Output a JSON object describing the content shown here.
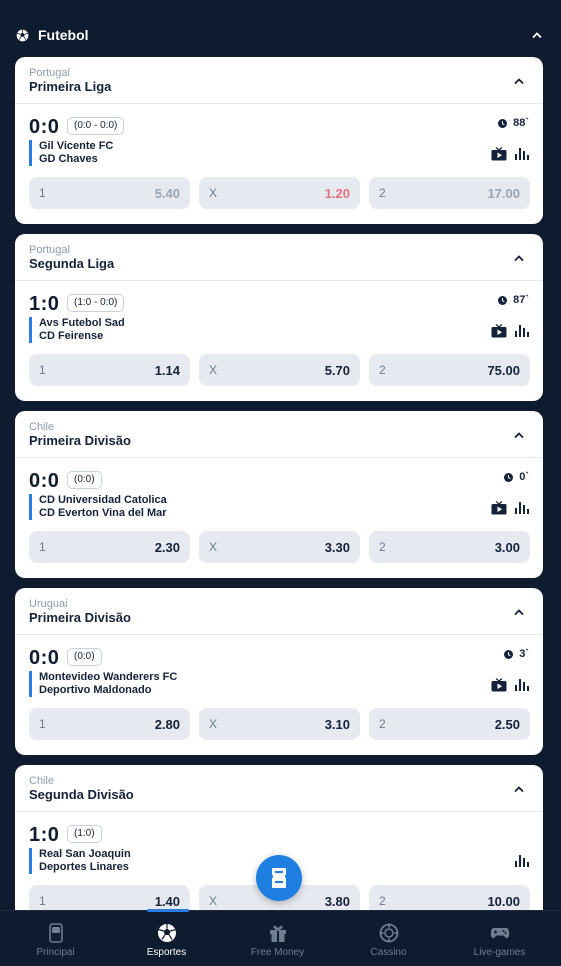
{
  "sport": {
    "title": "Futebol"
  },
  "matches": [
    {
      "country": "Portugal",
      "league": "Primeira Liga",
      "score": "0:0",
      "partial": "(0:0 - 0:0)",
      "home": "Gil Vicente FC",
      "away": "GD Chaves",
      "time": "88`",
      "has_tv": true,
      "odds": [
        {
          "label": "1",
          "value": "5.40"
        },
        {
          "label": "X",
          "value": "1.20"
        },
        {
          "label": "2",
          "value": "17.00"
        }
      ]
    },
    {
      "country": "Portugal",
      "league": "Segunda Liga",
      "score": "1:0",
      "partial": "(1:0 - 0:0)",
      "home": "Avs Futebol Sad",
      "away": "CD Feirense",
      "time": "87`",
      "has_tv": true,
      "odds": [
        {
          "label": "1",
          "value": "1.14"
        },
        {
          "label": "X",
          "value": "5.70"
        },
        {
          "label": "2",
          "value": "75.00"
        }
      ]
    },
    {
      "country": "Chile",
      "league": "Primeira Divisão",
      "score": "0:0",
      "partial": "(0:0)",
      "home": "CD Universidad Catolica",
      "away": "CD Everton Vina del Mar",
      "time": "0`",
      "has_tv": true,
      "odds": [
        {
          "label": "1",
          "value": "2.30"
        },
        {
          "label": "X",
          "value": "3.30"
        },
        {
          "label": "2",
          "value": "3.00"
        }
      ]
    },
    {
      "country": "Uruguai",
      "league": "Primeira Divisão",
      "score": "0:0",
      "partial": "(0:0)",
      "home": "Montevideo Wanderers FC",
      "away": "Deportivo Maldonado",
      "time": "3`",
      "has_tv": true,
      "odds": [
        {
          "label": "1",
          "value": "2.80"
        },
        {
          "label": "X",
          "value": "3.10"
        },
        {
          "label": "2",
          "value": "2.50"
        }
      ]
    },
    {
      "country": "Chile",
      "league": "Segunda Divisão",
      "score": "1:0",
      "partial": "(1:0)",
      "home": "Real San Joaquin",
      "away": "Deportes Linares",
      "time": "",
      "has_tv": false,
      "odds": [
        {
          "label": "1",
          "value": "1.40"
        },
        {
          "label": "X",
          "value": "3.80"
        },
        {
          "label": "2",
          "value": "10.00"
        }
      ]
    }
  ],
  "nav": [
    {
      "label": "Principal",
      "icon": "phone-icon"
    },
    {
      "label": "Esportes",
      "icon": "soccer-ball-icon"
    },
    {
      "label": "Free Money",
      "icon": "gift-icon"
    },
    {
      "label": "Cassino",
      "icon": "casino-chip-icon"
    },
    {
      "label": "Live-games",
      "icon": "gamepad-icon"
    }
  ],
  "colors": {
    "background": "#0f1b2e",
    "accent": "#2b7be4",
    "dropped_odd": "#e0707e"
  }
}
